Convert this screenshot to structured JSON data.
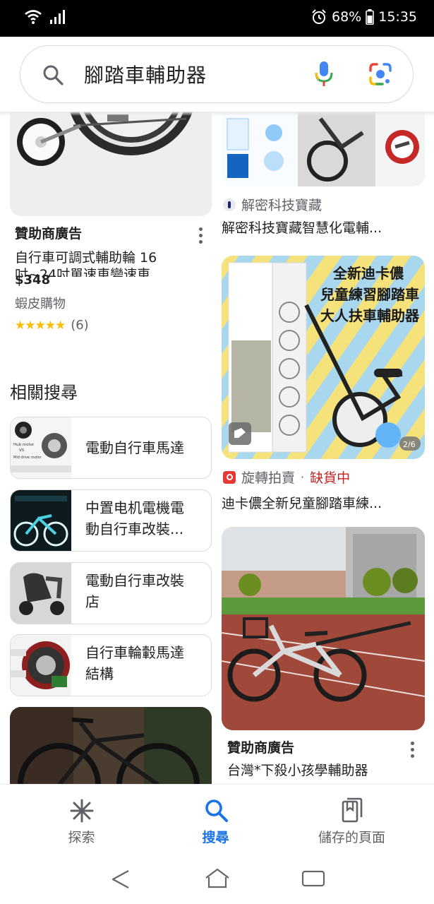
{
  "status_bar": {
    "battery": "68%",
    "time": "15:35"
  },
  "search": {
    "query": "腳踏車輔助器"
  },
  "left_column": {
    "ad": {
      "label": "贊助商廣告",
      "title_line1": "自行車可調式輔助輪 16",
      "title_line2": "吋~24吋單速車變速車",
      "price": "$348",
      "store": "蝦皮購物",
      "rating_count": "(6)"
    },
    "related_heading": "相關搜尋",
    "related": [
      {
        "line1": "電動自行車馬達",
        "line2": ""
      },
      {
        "line1": "中置电机電機電",
        "line2": "動自行車改裝..."
      },
      {
        "line1": "電動自行車改裝",
        "line2": "店"
      },
      {
        "line1": "自行車輪轂馬達",
        "line2": "結構"
      }
    ],
    "thumb_texts": {
      "hub_motor": "Hub motor",
      "vs": "VS",
      "mid_drive": "Mid drive motor"
    }
  },
  "right_column": {
    "card1": {
      "source": "解密科技寶藏",
      "title": "解密科技寶藏智慧化電輔..."
    },
    "card2": {
      "banner_line1": "全新迪卡儂",
      "banner_line2": "兒童練習腳踏車",
      "banner_line3": "大人扶車輔助器",
      "page_badge": "2/6",
      "source": "旋轉拍賣",
      "separator": "·",
      "stock_status": "缺貨中",
      "title": "迪卡儂全新兒童腳踏車練..."
    },
    "card3": {
      "label": "贊助商廣告",
      "title": "台灣*下殺小孩學輔助器"
    }
  },
  "bottom_nav": {
    "items": [
      {
        "label": "探索",
        "active": false
      },
      {
        "label": "搜尋",
        "active": true
      },
      {
        "label": "儲存的頁面",
        "active": false
      }
    ]
  },
  "colors": {
    "accent": "#1a73e8",
    "out_of_stock": "#c5221f",
    "star": "#fbbc04"
  }
}
